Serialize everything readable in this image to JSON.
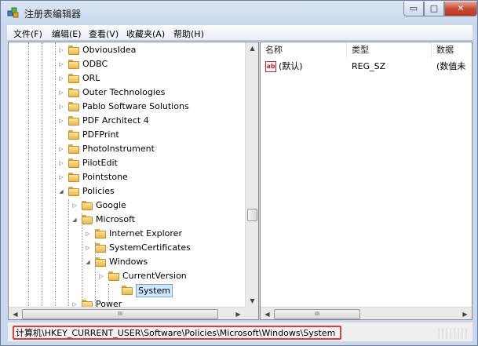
{
  "window": {
    "title": "注册表编辑器"
  },
  "titlebar_buttons": {
    "minimize": "▭",
    "maximize": "□",
    "close": "✕"
  },
  "menu": [
    "文件(F)",
    "编辑(E)",
    "查看(V)",
    "收藏夹(A)",
    "帮助(H)"
  ],
  "tree": [
    {
      "label": "ObviousIdea",
      "expander": "▷"
    },
    {
      "label": "ODBC",
      "expander": "▷"
    },
    {
      "label": "ORL",
      "expander": "▷"
    },
    {
      "label": "Outer Technologies",
      "expander": "▷"
    },
    {
      "label": "Pablo Software Solutions",
      "expander": "▷"
    },
    {
      "label": "PDF Architect 4",
      "expander": "▷"
    },
    {
      "label": "PDFPrint",
      "expander": ""
    },
    {
      "label": "PhotoInstrument",
      "expander": "▷"
    },
    {
      "label": "PilotEdit",
      "expander": "▷"
    },
    {
      "label": "Pointstone",
      "expander": "▷"
    },
    {
      "label": "Policies",
      "expander": "◢"
    },
    {
      "label": "Google",
      "expander": "▷"
    },
    {
      "label": "Microsoft",
      "expander": "◢"
    },
    {
      "label": "Internet Explorer",
      "expander": "▷"
    },
    {
      "label": "SystemCertificates",
      "expander": "▷"
    },
    {
      "label": "Windows",
      "expander": "◢"
    },
    {
      "label": "CurrentVersion",
      "expander": "▷"
    },
    {
      "label": "System",
      "expander": "",
      "selected": true
    },
    {
      "label": "Power",
      "expander": "▷"
    }
  ],
  "scroll": {
    "up": "▲",
    "down": "▼",
    "left": "◀",
    "right": "▶",
    "grip": "III"
  },
  "values_table": {
    "columns": [
      "名称",
      "类型",
      "数据"
    ],
    "rows": [
      {
        "icon": "ab",
        "name": "(默认)",
        "type": "REG_SZ",
        "data": "(数值未设置)"
      }
    ]
  },
  "statusbar": {
    "path": "计算机\\HKEY_CURRENT_USER\\Software\\Policies\\Microsoft\\Windows\\System"
  },
  "colors": {
    "selection": "#cce8ff",
    "highlight_box": "#e23b3b",
    "folder": "#e9b64a"
  }
}
